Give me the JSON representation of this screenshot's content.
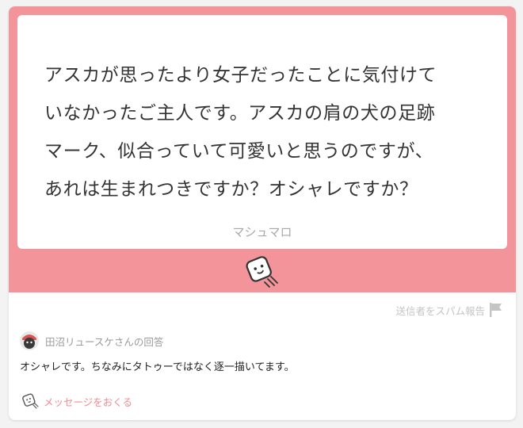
{
  "question": {
    "lines": [
      "アスカが思ったより女子だったことに気付けて",
      "いなかったご主人です。アスカの肩の犬の足跡",
      "マーク、似合っていて可愛いと思うのですが、",
      "あれは生まれつきですか？オシャレですか？"
    ],
    "brand": "マシュマロ"
  },
  "report": {
    "label": "送信者をスパム報告",
    "icon": "flag-icon"
  },
  "answer": {
    "answerer": "田沼リュースケさんの回答",
    "text": "オシャレです。ちなみにタトゥーではなく逐一描いてます。"
  },
  "send": {
    "label": "メッセージをおくる",
    "icon": "marshmallow-send-icon"
  },
  "colors": {
    "accent": "#f2949a",
    "link": "#ef8c92",
    "muted": "#a8a8a8",
    "text": "#333333"
  }
}
